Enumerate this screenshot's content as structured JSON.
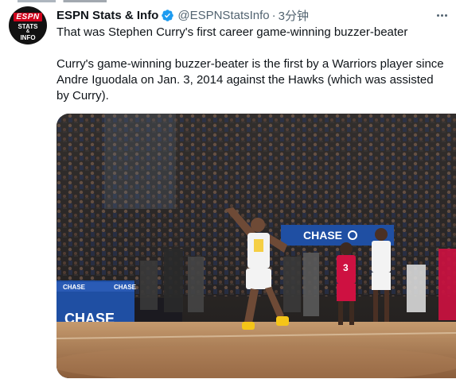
{
  "tweet": {
    "author_name": "ESPN Stats & Info",
    "handle": "@ESPNStatsInfo",
    "separator": "·",
    "time": "3分钟",
    "text_line1": "That was Stephen Curry's first career game-winning buzzer-beater",
    "text_line2": "Curry's game-winning buzzer-beater is the first by a Warriors player since Andre Iguodala on Jan. 3, 2014 against the Hawks (which was assisted by Curry).",
    "avatar_text": {
      "brand": "ESPN",
      "line1": "STATS",
      "line2": "&",
      "line3": "INFO"
    },
    "verified": true
  },
  "media": {
    "banner_text": "CHASE",
    "sign_small_left": "CHASE",
    "sign_small_right": "CHASE",
    "sign_large": "CHASE",
    "jersey_number": "3"
  },
  "colors": {
    "verified_blue": "#1d9bf0",
    "text_primary": "#0f1419",
    "text_secondary": "#536471",
    "espn_red": "#d0021b",
    "chase_blue": "#1f4fa3",
    "warriors_gold": "#f5c518",
    "rockets_red": "#ce1141"
  },
  "icons": [
    "verified-badge-icon",
    "more-options-icon",
    "chase-logo-icon"
  ]
}
